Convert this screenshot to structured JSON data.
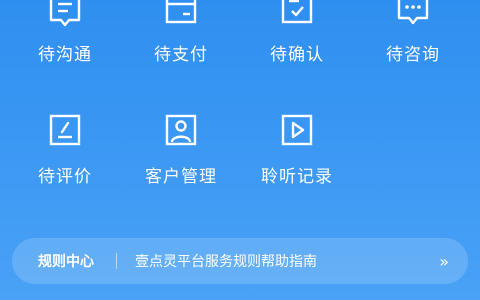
{
  "grid": {
    "items": [
      {
        "label": "待沟通",
        "icon": "chat-document-icon"
      },
      {
        "label": "待支付",
        "icon": "card-icon"
      },
      {
        "label": "待确认",
        "icon": "check-document-icon"
      },
      {
        "label": "待咨询",
        "icon": "chat-bubble-icon"
      },
      {
        "label": "待评价",
        "icon": "edit-icon"
      },
      {
        "label": "客户管理",
        "icon": "user-icon"
      },
      {
        "label": "聆听记录",
        "icon": "play-icon"
      }
    ]
  },
  "rules": {
    "title": "规则中心",
    "description": "壹点灵平台服务规则帮助指南",
    "arrow": "››"
  },
  "colors": {
    "background_top": "#2f8ff0",
    "background_bottom": "#4aa2f6",
    "foreground": "#ffffff"
  }
}
